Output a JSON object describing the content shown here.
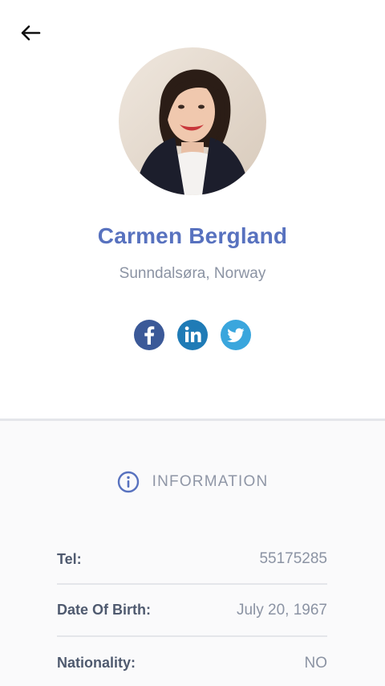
{
  "profile": {
    "name": "Carmen Bergland",
    "location": "Sunndalsøra, Norway"
  },
  "socials": [
    {
      "network": "facebook",
      "icon": "facebook-icon",
      "color": "#3b5998"
    },
    {
      "network": "linkedin",
      "icon": "linkedin-icon",
      "color": "#1f7bb6"
    },
    {
      "network": "twitter",
      "icon": "twitter-icon",
      "color": "#3aa6dd"
    }
  ],
  "info": {
    "title": "INFORMATION",
    "rows": [
      {
        "label": "Tel:",
        "value": "55175285"
      },
      {
        "label": "Date Of Birth:",
        "value": "July 20, 1967"
      },
      {
        "label": "Nationality:",
        "value": "NO"
      }
    ]
  },
  "colors": {
    "accent": "#5872bf",
    "muted": "#8b93a3",
    "label": "#4f5a6f",
    "divider": "#e4e6ea"
  }
}
